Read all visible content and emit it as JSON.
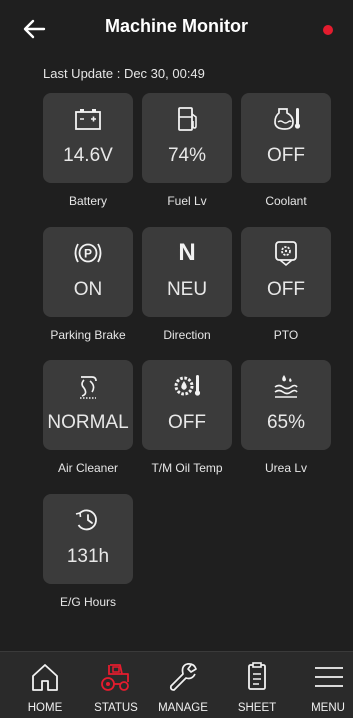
{
  "header": {
    "title": "Machine Monitor",
    "back_icon": "arrow-left-icon",
    "status_color": "#e41c2e"
  },
  "last_update": "Last Update : Dec 30, 00:49",
  "tiles": [
    {
      "icon": "battery-icon",
      "value": "14.6V",
      "label": "Battery"
    },
    {
      "icon": "fuel-pump-icon",
      "value": "74%",
      "label": "Fuel Lv"
    },
    {
      "icon": "coolant-temp-icon",
      "value": "OFF",
      "label": "Coolant"
    },
    {
      "icon": "parking-brake-icon",
      "value": "ON",
      "label": "Parking Brake"
    },
    {
      "icon": "neutral-icon",
      "icon_text": "N",
      "value": "NEU",
      "label": "Direction"
    },
    {
      "icon": "pto-icon",
      "value": "OFF",
      "label": "PTO"
    },
    {
      "icon": "air-cleaner-icon",
      "value": "NORMAL",
      "label": "Air Cleaner"
    },
    {
      "icon": "oil-temp-icon",
      "value": "OFF",
      "label": "T/M Oil Temp"
    },
    {
      "icon": "urea-level-icon",
      "value": "65%",
      "label": "Urea Lv"
    },
    {
      "icon": "engine-hours-icon",
      "value": "131h",
      "label": "E/G Hours"
    }
  ],
  "nav": {
    "active_color": "#e41c2e",
    "items": [
      {
        "icon": "home-icon",
        "label": "HOME"
      },
      {
        "icon": "tractor-icon",
        "label": "STATUS",
        "active": true
      },
      {
        "icon": "wrench-icon",
        "label": "MANAGE"
      },
      {
        "icon": "clipboard-icon",
        "label": "SHEET"
      },
      {
        "icon": "menu-icon",
        "label": "MENU"
      }
    ]
  }
}
